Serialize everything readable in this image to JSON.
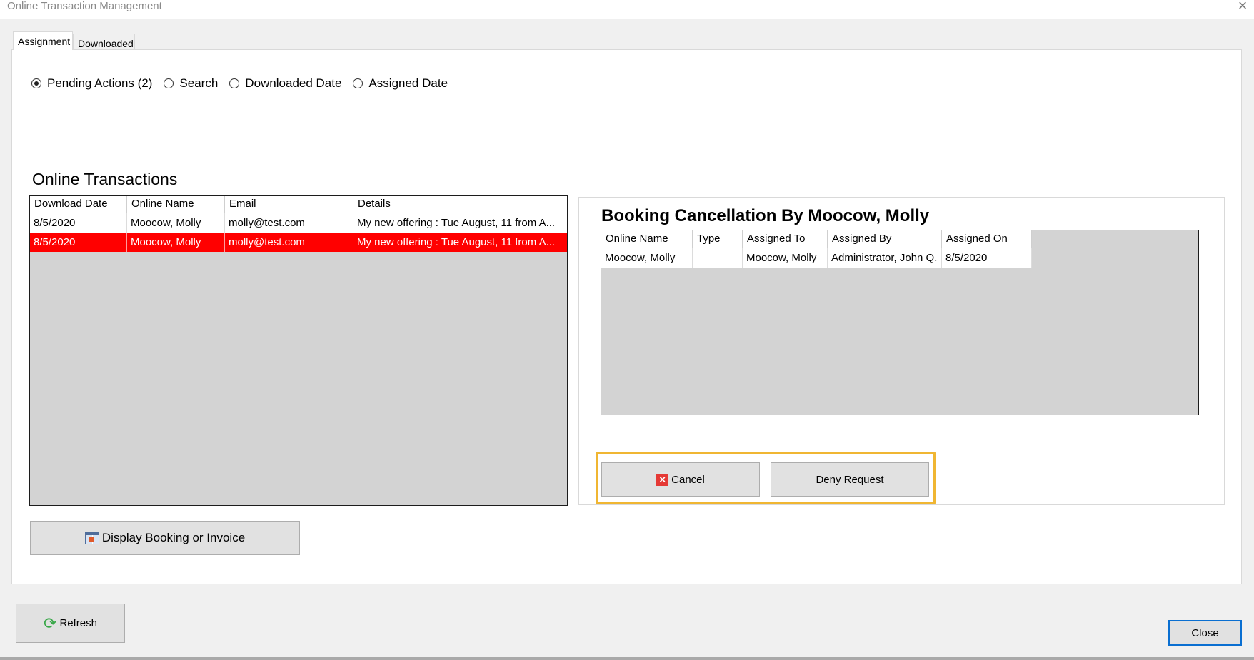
{
  "window": {
    "title": "Online Transaction Management",
    "close_glyph": "×"
  },
  "tabs": [
    {
      "label": "Assignment",
      "active": true
    },
    {
      "label": "Downloaded",
      "active": false
    }
  ],
  "filters": [
    {
      "label": "Pending Actions (2)",
      "checked": true
    },
    {
      "label": "Search",
      "checked": false
    },
    {
      "label": "Downloaded Date",
      "checked": false
    },
    {
      "label": "Assigned Date",
      "checked": false
    }
  ],
  "transactions": {
    "title": "Online Transactions",
    "columns": [
      "Download Date",
      "Online Name",
      "Email",
      "Details"
    ],
    "rows": [
      {
        "download_date": "8/5/2020",
        "online_name": "Moocow, Molly",
        "email": "molly@test.com",
        "details": "My new offering : Tue August, 11 from A...",
        "selected": false
      },
      {
        "download_date": "8/5/2020",
        "online_name": "Moocow, Molly",
        "email": "molly@test.com",
        "details": "My new offering : Tue August, 11 from A...",
        "selected": true
      }
    ]
  },
  "booking": {
    "title": "Booking Cancellation By Moocow, Molly",
    "columns": [
      "Online Name",
      "Type",
      "Assigned To",
      "Assigned By",
      "Assigned On"
    ],
    "rows": [
      {
        "online_name": "Moocow, Molly",
        "type": "",
        "assigned_to": "Moocow, Molly",
        "assigned_by": "Administrator, John Q.",
        "assigned_on": "8/5/2020"
      }
    ]
  },
  "actions": {
    "cancel_label": "Cancel",
    "deny_label": "Deny Request",
    "display_label": "Display Booking or Invoice",
    "refresh_label": "Refresh",
    "close_label": "Close"
  },
  "icons": {
    "cancel": "cancel-x-icon",
    "display": "invoice-grid-icon",
    "refresh": "refresh-icon"
  },
  "colors": {
    "selected_row": "#ff0000",
    "highlight": "#f0b632",
    "close_border": "#0a6fd1"
  }
}
